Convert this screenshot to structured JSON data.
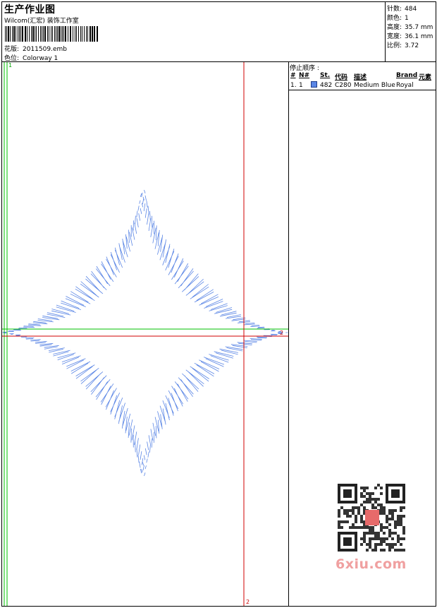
{
  "header": {
    "title": "生产作业图",
    "studio": "Wilcom(汇宏) 装饰工作室",
    "design_label": "花版:",
    "design_file": "2011509.emb",
    "colorway_label": "色位:",
    "colorway": "Colorway 1"
  },
  "stats": [
    {
      "label": "针数:",
      "value": "484"
    },
    {
      "label": "颜色:",
      "value": "1"
    },
    {
      "label": "高度:",
      "value": "35.7 mm"
    },
    {
      "label": "宽度:",
      "value": "36.1 mm"
    },
    {
      "label": "比例:",
      "value": "3.72"
    }
  ],
  "stop_sequence": {
    "title": "停止顺序 :",
    "headers": [
      "#",
      "N#",
      "St.",
      "代码",
      "描述",
      "Brand",
      "元素"
    ],
    "rows": [
      {
        "index": "1.",
        "needle": "1",
        "stitches": "482",
        "code": "C280",
        "description": "Medium Blue",
        "brand": "Royal",
        "color": "#5b86e5"
      }
    ]
  },
  "guides": {
    "top_left_label": "1",
    "right_label": "2",
    "bottom_label": "2"
  },
  "watermark": {
    "text": "6xiu.com"
  },
  "colors": {
    "stitch": "#5b86e5",
    "guide_red": "#d00000",
    "guide_green": "#00c000"
  }
}
